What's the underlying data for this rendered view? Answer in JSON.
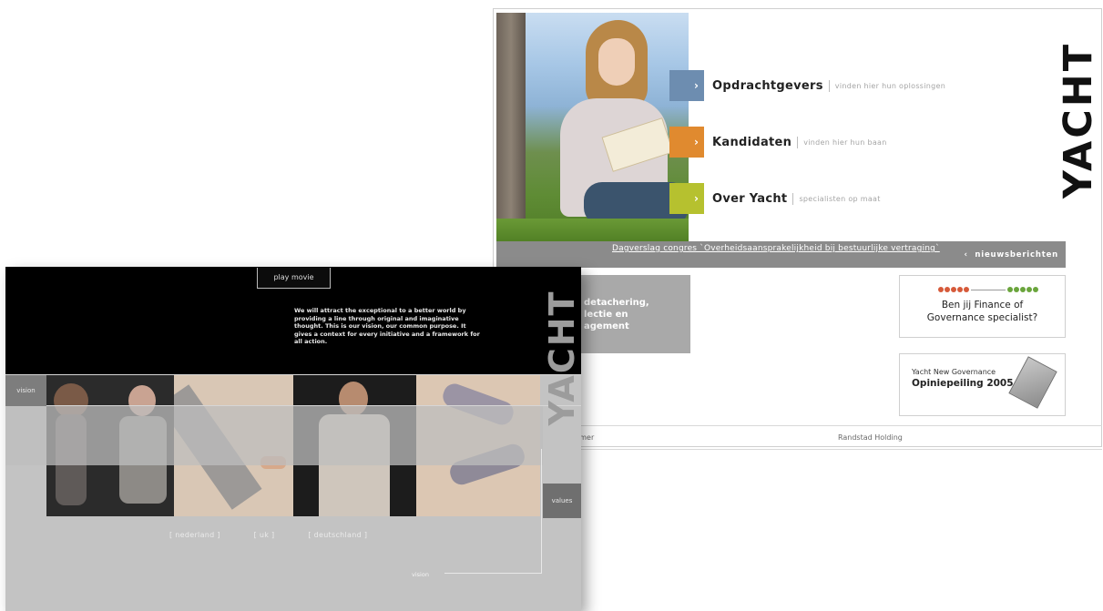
{
  "right_site": {
    "brand": "YACHT",
    "nav": [
      {
        "title": "Opdrachtgevers",
        "subtitle": "vinden hier hun oplossingen",
        "color": "#6d8db0"
      },
      {
        "title": "Kandidaten",
        "subtitle": "vinden hier hun baan",
        "color": "#e08a2f"
      },
      {
        "title": "Over Yacht",
        "subtitle": "specialisten op maat",
        "color": "#b6c12f"
      }
    ],
    "news_link": "Dagverslag congres `Overheidsaansprakelijkheid bij bestuurlijke vertraging`",
    "news_button": "nieuwsberichten",
    "detachering_lines": [
      "detachering,",
      "lectie en",
      "agement"
    ],
    "finance_lines": [
      "Ben jij Finance of",
      "Governance specialist?"
    ],
    "governance_line1": "Yacht New Governance",
    "governance_line2": "Opiniepeiling 2005",
    "footer_left": "imer",
    "footer_right": "Randstad Holding",
    "dot_colors": [
      "#d65a3a",
      "#6aa53c"
    ]
  },
  "left_site": {
    "play_button": "play movie",
    "mission_text": "We will attract the exceptional to a better world by providing a line through original and imaginative thought. This is our vision, our common purpose. It gives a context for every initiative and a framework for all action.",
    "brand": "YACHT",
    "vision_button": "vision",
    "values_button": "values",
    "languages": [
      "[ nederland ]",
      "[ uk ]",
      "[ deutschland ]"
    ],
    "vision_bottom": "vision"
  }
}
